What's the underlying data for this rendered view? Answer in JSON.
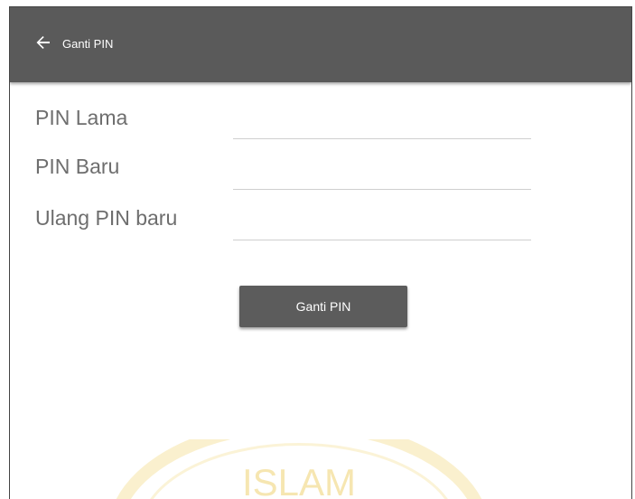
{
  "appbar": {
    "back_icon": "arrow-left-icon",
    "title": "Ganti PIN",
    "background": "#5a5a5a"
  },
  "form": {
    "fields": [
      {
        "label": "PIN Lama",
        "value": ""
      },
      {
        "label": "PIN Baru",
        "value": ""
      },
      {
        "label": "Ulang PIN baru",
        "value": ""
      }
    ],
    "submit_label": "Ganti PIN",
    "button_color": "#5c5c5c"
  },
  "watermark": {
    "text": "ISLAM",
    "color": "#f2d98a"
  }
}
